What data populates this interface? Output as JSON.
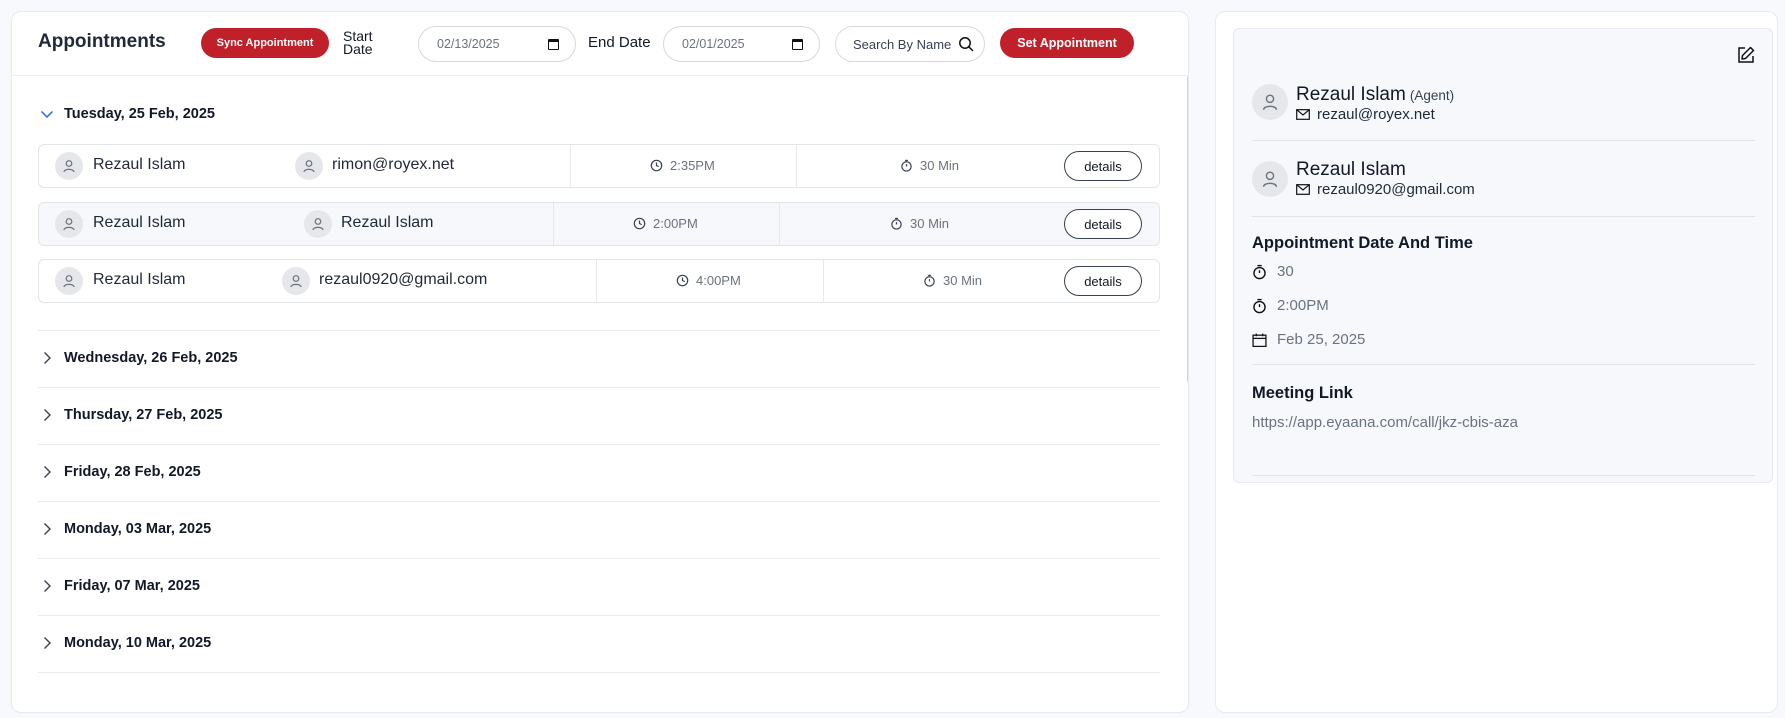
{
  "header": {
    "title": "Appointments",
    "sync_label": "Sync Appointment",
    "start_label": "Start Date",
    "start_value": "02/13/2025",
    "end_label": "End Date",
    "end_value": "02/01/2025",
    "search_placeholder": "Search By Name",
    "set_label": "Set Appointment"
  },
  "days": [
    {
      "label": "Tuesday, 25 Feb, 2025",
      "expanded": true,
      "rows": [
        {
          "agent": "Rezaul Islam",
          "client": "rimon@royex.net",
          "time": "2:35PM",
          "duration": "30 Min",
          "action": "details"
        },
        {
          "agent": "Rezaul Islam",
          "client": "Rezaul Islam",
          "time": "2:00PM",
          "duration": "30 Min",
          "action": "details"
        },
        {
          "agent": "Rezaul Islam",
          "client": "rezaul0920@gmail.com",
          "time": "4:00PM",
          "duration": "30 Min",
          "action": "details"
        }
      ]
    },
    {
      "label": "Wednesday, 26 Feb, 2025",
      "expanded": false
    },
    {
      "label": "Thursday, 27 Feb, 2025",
      "expanded": false
    },
    {
      "label": "Friday, 28 Feb, 2025",
      "expanded": false
    },
    {
      "label": "Monday, 03 Mar, 2025",
      "expanded": false
    },
    {
      "label": "Friday, 07 Mar, 2025",
      "expanded": false
    },
    {
      "label": "Monday, 10 Mar, 2025",
      "expanded": false
    }
  ],
  "detail": {
    "agent_name": "Rezaul Islam",
    "agent_role": "(Agent)",
    "agent_email": "rezaul@royex.net",
    "client_name": "Rezaul Islam",
    "client_email": "rezaul0920@gmail.com",
    "datetime_title": "Appointment Date And Time",
    "duration": "30",
    "time": "2:00PM",
    "date": "Feb 25, 2025",
    "meeting_title": "Meeting Link",
    "meeting_link": "https://app.eyaana.com/call/jkz-cbis-aza"
  },
  "colors": {
    "accent": "#c0202a",
    "muted": "#6b7280"
  }
}
